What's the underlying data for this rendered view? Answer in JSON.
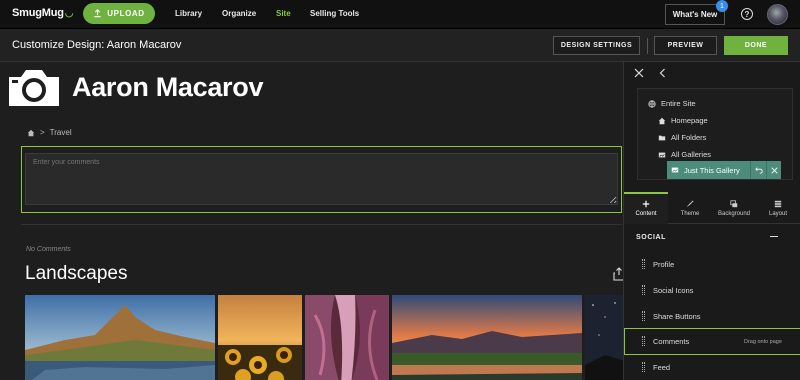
{
  "topnav": {
    "logo_text": "SmugMug",
    "upload_label": "UPLOAD",
    "links": [
      {
        "label": "Library",
        "active": false
      },
      {
        "label": "Organize",
        "active": false
      },
      {
        "label": "Site",
        "active": true
      },
      {
        "label": "Selling Tools",
        "active": false
      }
    ],
    "whats_new_label": "What's New",
    "badge_count": "1",
    "help_glyph": "?"
  },
  "customize_bar": {
    "title": "Customize Design: Aaron Macarov",
    "design_settings_label": "DESIGN SETTINGS",
    "preview_label": "PREVIEW",
    "done_label": "DONE"
  },
  "page": {
    "site_name": "Aaron Macarov",
    "breadcrumb_sep": ">",
    "breadcrumb_item": "Travel",
    "comment_placeholder": "Enter your comments",
    "no_comments": "No Comments",
    "gallery_title": "Landscapes"
  },
  "panel": {
    "scope": {
      "items": [
        "Entire Site",
        "Homepage",
        "All Folders",
        "All Galleries"
      ],
      "selected": "Just This Gallery"
    },
    "tabs": [
      {
        "label": "Content",
        "icon": "plus-icon",
        "active": true
      },
      {
        "label": "Theme",
        "icon": "brush-icon",
        "active": false
      },
      {
        "label": "Background",
        "icon": "background-icon",
        "active": false
      },
      {
        "label": "Layout",
        "icon": "layout-icon",
        "active": false
      }
    ],
    "section_title": "SOCIAL",
    "widgets": [
      "Profile",
      "Social Icons",
      "Share Buttons",
      "Comments",
      "Feed"
    ],
    "drag_hint": "Drag onto page"
  },
  "colors": {
    "accent_green": "#6fb23f",
    "selection_green": "#8cc63f",
    "scope_selected": "#4c8c7a",
    "badge_blue": "#3b8ee8"
  }
}
